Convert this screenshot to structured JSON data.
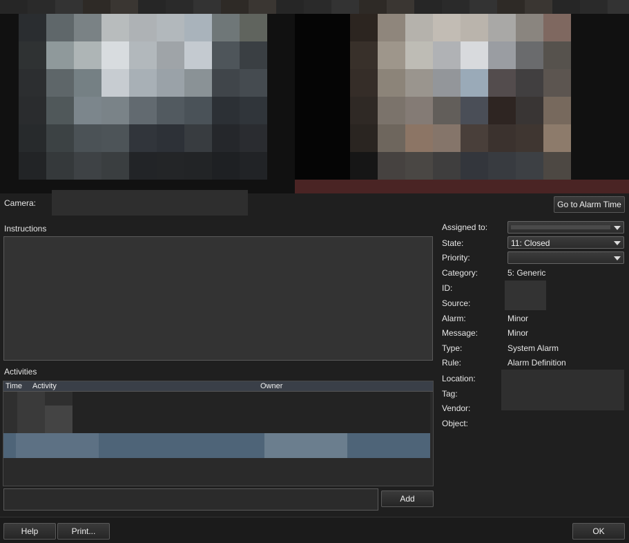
{
  "video": {
    "description_colors": [
      "#2c2f33",
      "#5e6566",
      "#9aa3a8",
      "#c9ced2"
    ]
  },
  "camera": {
    "label": "Camera:",
    "goto_button": "Go to Alarm Time"
  },
  "instructions": {
    "label": "Instructions"
  },
  "activities": {
    "label": "Activities",
    "columns": {
      "time": "Time",
      "activity": "Activity",
      "owner": "Owner"
    },
    "add_button": "Add",
    "input_value": ""
  },
  "details": {
    "assigned_to": {
      "label": "Assigned to:",
      "value": ""
    },
    "state": {
      "label": "State:",
      "value": "11: Closed"
    },
    "priority": {
      "label": "Priority:",
      "value": ""
    },
    "category": {
      "label": "Category:",
      "value": "5: Generic"
    },
    "id": {
      "label": "ID:"
    },
    "source": {
      "label": "Source:"
    },
    "alarm": {
      "label": "Alarm:",
      "value": "Minor"
    },
    "message": {
      "label": "Message:",
      "value": "Minor"
    },
    "type": {
      "label": "Type:",
      "value": "System Alarm"
    },
    "rule": {
      "label": "Rule:",
      "value": "Alarm Definition"
    },
    "location": {
      "label": "Location:"
    },
    "tag": {
      "label": "Tag:"
    },
    "vendor": {
      "label": "Vendor:"
    },
    "object": {
      "label": "Object:"
    }
  },
  "footer": {
    "help": "Help",
    "print": "Print...",
    "ok": "OK"
  }
}
